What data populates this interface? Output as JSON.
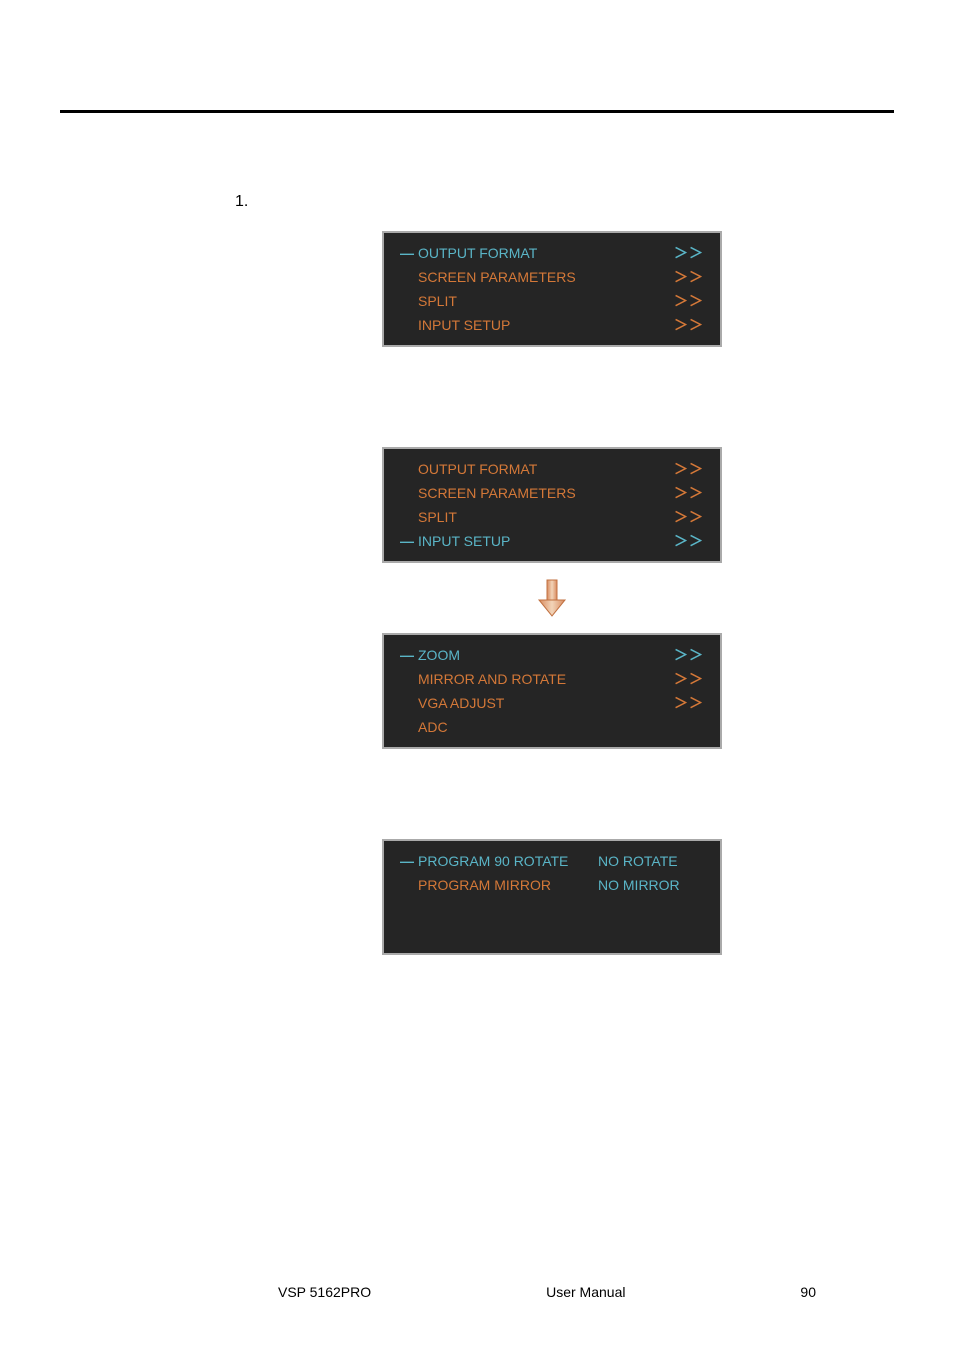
{
  "list_number": "1.",
  "menu1": {
    "items": [
      {
        "marker": "—",
        "label": "OUTPUT FORMAT",
        "arrow": "＞＞",
        "active": true
      },
      {
        "marker": "",
        "label": "SCREEN PARAMETERS",
        "arrow": "＞＞",
        "active": false
      },
      {
        "marker": "",
        "label": "SPLIT",
        "arrow": "＞＞",
        "active": false
      },
      {
        "marker": "",
        "label": "INPUT SETUP",
        "arrow": "＞＞",
        "active": false
      }
    ]
  },
  "menu2": {
    "items": [
      {
        "marker": "",
        "label": "OUTPUT FORMAT",
        "arrow": "＞＞",
        "active": false
      },
      {
        "marker": "",
        "label": "SCREEN PARAMETERS",
        "arrow": "＞＞",
        "active": false
      },
      {
        "marker": "",
        "label": "SPLIT",
        "arrow": "＞＞",
        "active": false
      },
      {
        "marker": "—",
        "label": "INPUT SETUP",
        "arrow": "＞＞",
        "active": true
      }
    ]
  },
  "menu3": {
    "items": [
      {
        "marker": "—",
        "label": "ZOOM",
        "arrow": "＞＞",
        "active": true
      },
      {
        "marker": "",
        "label": "MIRROR AND ROTATE",
        "arrow": "＞＞",
        "active": false
      },
      {
        "marker": "",
        "label": "VGA ADJUST",
        "arrow": "＞＞",
        "active": false
      },
      {
        "marker": "",
        "label": "ADC",
        "arrow": "",
        "active": false
      }
    ]
  },
  "menu4": {
    "items": [
      {
        "marker": "—",
        "label": "PROGRAM 90 ROTATE",
        "value": "NO ROTATE"
      },
      {
        "marker": "",
        "label": "PROGRAM MIRROR",
        "value": "NO MIRROR"
      },
      {
        "marker": "",
        "label": "",
        "value": ""
      },
      {
        "marker": "",
        "label": "",
        "value": ""
      }
    ]
  },
  "footer": {
    "product": "VSP 5162PRO",
    "doc_type": "User Manual",
    "page": "90"
  }
}
